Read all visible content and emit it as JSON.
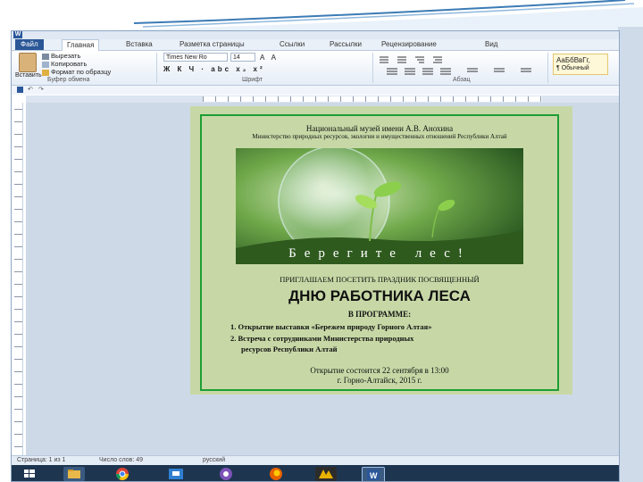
{
  "app": {
    "logo": "W"
  },
  "ribbon_tabs": [
    {
      "label": "Файл"
    },
    {
      "label": "Главная"
    },
    {
      "label": "Вставка"
    },
    {
      "label": "Разметка страницы"
    },
    {
      "label": "Ссылки"
    },
    {
      "label": "Рассылки"
    },
    {
      "label": "Рецензирование"
    },
    {
      "label": "Вид"
    }
  ],
  "clipboard": {
    "paste": "Вставить",
    "cut": "Вырезать",
    "copy": "Копировать",
    "format_painter": "Формат по образцу",
    "group_label": "Буфер обмена"
  },
  "font": {
    "name": "Times New Ro",
    "size": "14",
    "format_glyphs": "Ж К Ч · abc x₂ x²",
    "grow_shrink": "A A",
    "group_label": "Шрифт"
  },
  "paragraph": {
    "group_label": "Абзац"
  },
  "styles": {
    "style1": "АаБбВвГг,",
    "style2": "¶ Обычный"
  },
  "status_bar": {
    "page": "Страница: 1 из 1",
    "words": "Число слов: 49",
    "language": "русский"
  },
  "document": {
    "header_line1": "Национальный музей имени А.В. Анохина",
    "header_line2": "Министерство природных ресурсов, экологии и имущественных отношений Республики Алтай",
    "photo_caption": "Берегите лес!",
    "invite": "ПРИГЛАШАЕМ ПОСЕТИТЬ ПРАЗДНИК ПОСВЯЩЕННЫЙ",
    "title": "ДНЮ РАБОТНИКА ЛЕСА",
    "program_heading": "В ПРОГРАММЕ:",
    "program_item1": "1. Открытие выставки «Бережем природу Горного Алтая»",
    "program_item2a": "2. Встреча с сотрудниками Министерства природных",
    "program_item2b": "ресурсов Республики Алтай",
    "footer_line1": "Открытие состоится 22 сентября в 13:00",
    "footer_line2": "г. Горно-Алтайск, 2015 г."
  },
  "colors": {
    "page_background": "#c7d8a6",
    "page_border": "#1d9e34",
    "ribbon_file_tab": "#2b5797",
    "taskbar": "#1e3550"
  },
  "taskbar_icons": [
    "windows-start",
    "file-explorer",
    "chrome",
    "app-blue",
    "viber",
    "firefox",
    "adobe-app",
    "word"
  ]
}
